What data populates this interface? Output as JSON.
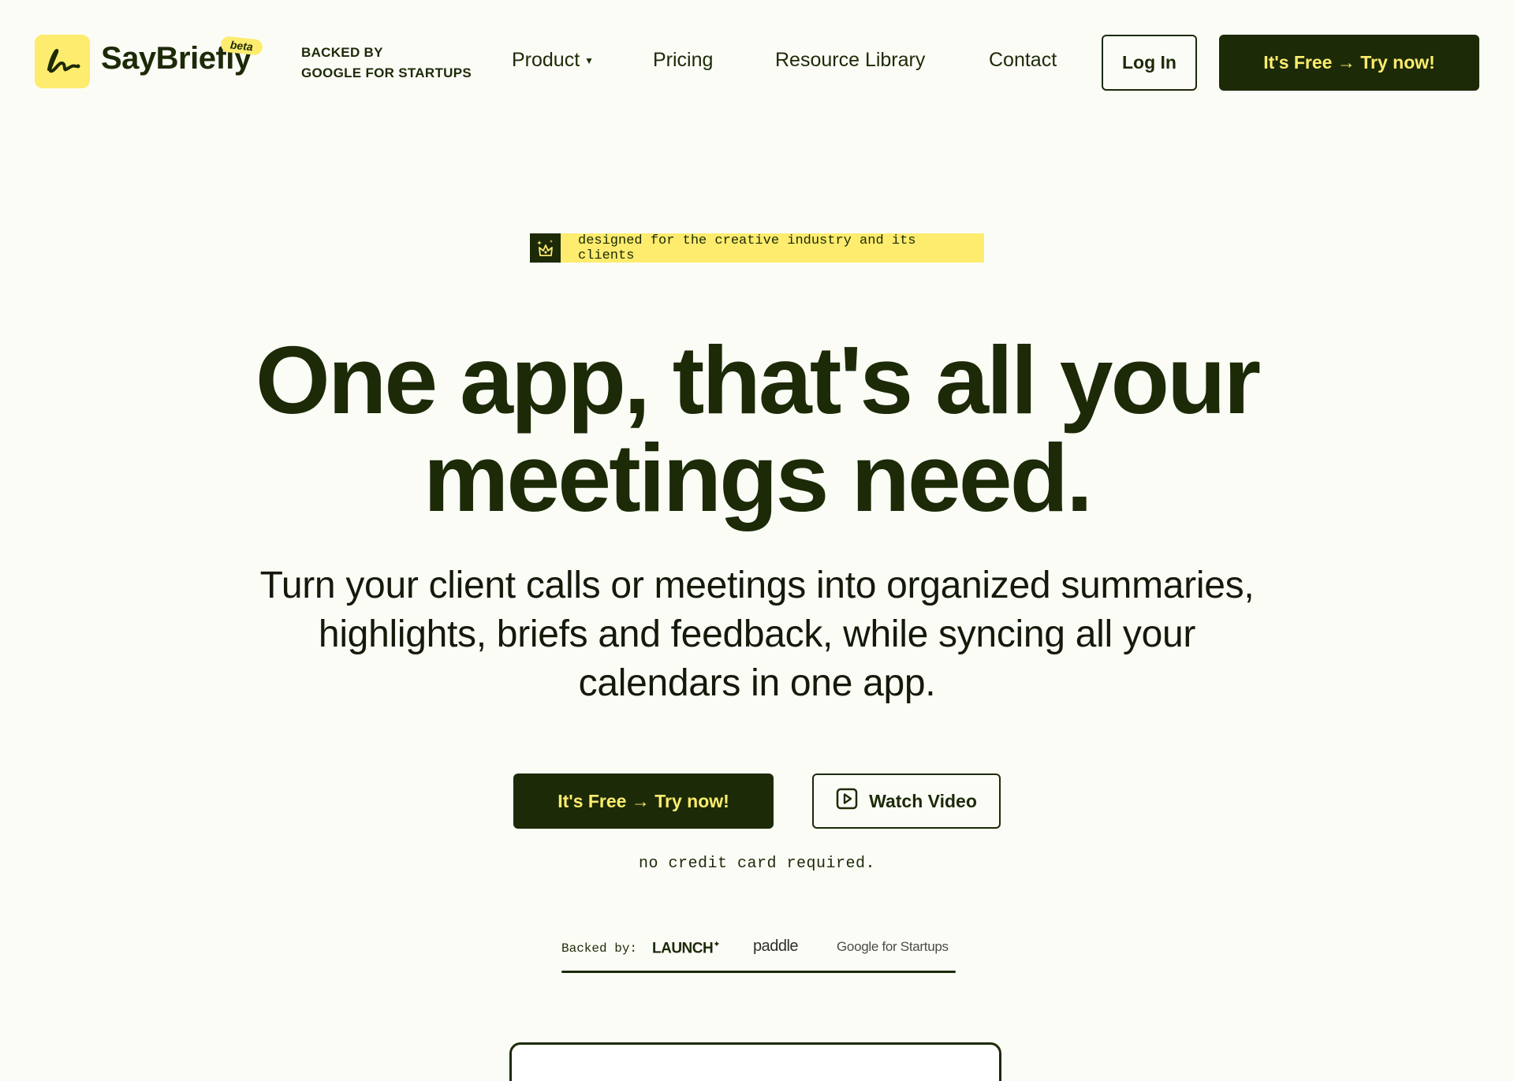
{
  "nav": {
    "brand": "SayBriefly",
    "beta": "beta",
    "backed_line1": "BACKED BY",
    "backed_line2": "GOOGLE FOR STARTUPS",
    "product": "Product",
    "pricing": "Pricing",
    "resources": "Resource Library",
    "contact": "Contact",
    "login": "Log In",
    "cta": "It's Free → Try now!"
  },
  "hero": {
    "tagline": "designed for the creative industry and its clients",
    "headline_line1": "One app, that's all your",
    "headline_line2": "meetings need.",
    "subhead_line1": "Turn your client calls or meetings into organized summaries,",
    "subhead_line2": "highlights, briefs and feedback, while syncing all your",
    "subhead_line3": "calendars in one app.",
    "cta": "It's Free → Try now!",
    "watch": "Watch Video",
    "no_cc": "no credit card required."
  },
  "backers": {
    "label": "Backed by:",
    "launch": "LAUNCH",
    "paddle": "paddle",
    "google": "Google for Startups"
  },
  "icons": {
    "logo": "scribble-logo-icon",
    "tagline": "sparkle-crown-icon",
    "watch": "play-icon",
    "dropdown": "caret-down-icon"
  },
  "colors": {
    "background": "#fcfcf7",
    "primary": "#1c2a07",
    "accent": "#fdec6e"
  }
}
